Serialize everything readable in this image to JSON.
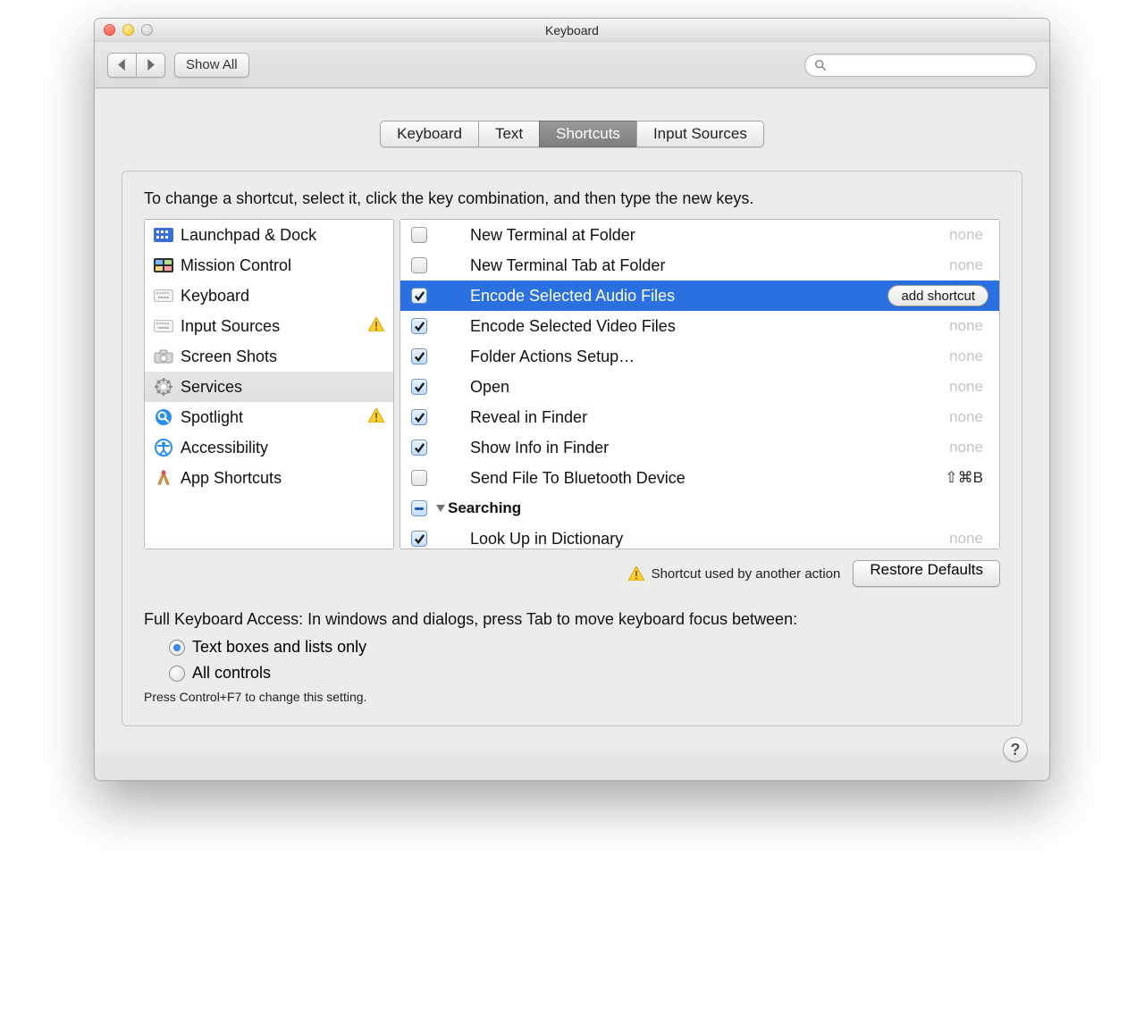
{
  "window": {
    "title": "Keyboard"
  },
  "toolbar": {
    "show_all": "Show All",
    "search_placeholder": ""
  },
  "tabs": [
    "Keyboard",
    "Text",
    "Shortcuts",
    "Input Sources"
  ],
  "tabs_selected_index": 2,
  "instruction": "To change a shortcut, select it, click the key combination, and then type the new keys.",
  "categories": [
    {
      "label": "Launchpad & Dock",
      "icon": "launchpad",
      "warn": false
    },
    {
      "label": "Mission Control",
      "icon": "mission",
      "warn": false
    },
    {
      "label": "Keyboard",
      "icon": "keyboard",
      "warn": false
    },
    {
      "label": "Input Sources",
      "icon": "keyboard",
      "warn": true
    },
    {
      "label": "Screen Shots",
      "icon": "camera",
      "warn": false
    },
    {
      "label": "Services",
      "icon": "gear",
      "warn": false,
      "selected": true
    },
    {
      "label": "Spotlight",
      "icon": "spotlight",
      "warn": true
    },
    {
      "label": "Accessibility",
      "icon": "accessibility",
      "warn": false
    },
    {
      "label": "App Shortcuts",
      "icon": "app",
      "warn": false
    }
  ],
  "shortcuts": [
    {
      "label": "New Terminal at Folder",
      "checked": false,
      "shortcut": "none",
      "selected": false
    },
    {
      "label": "New Terminal Tab at Folder",
      "checked": false,
      "shortcut": "none",
      "selected": false
    },
    {
      "label": "Encode Selected Audio Files",
      "checked": true,
      "shortcut": "add shortcut",
      "selected": true,
      "shortcut_pill": true
    },
    {
      "label": "Encode Selected Video Files",
      "checked": true,
      "shortcut": "none",
      "selected": false
    },
    {
      "label": "Folder Actions Setup…",
      "checked": true,
      "shortcut": "none",
      "selected": false
    },
    {
      "label": "Open",
      "checked": true,
      "shortcut": "none",
      "selected": false
    },
    {
      "label": "Reveal in Finder",
      "checked": true,
      "shortcut": "none",
      "selected": false
    },
    {
      "label": "Show Info in Finder",
      "checked": true,
      "shortcut": "none",
      "selected": false
    },
    {
      "label": "Send File To Bluetooth Device",
      "checked": false,
      "shortcut": "⇧⌘B",
      "shortcut_strong": true,
      "selected": false
    },
    {
      "group": true,
      "label": "Searching",
      "checked": "mixed"
    },
    {
      "label": "Look Up in Dictionary",
      "checked": true,
      "shortcut": "none",
      "selected": false
    }
  ],
  "conflict_note": "Shortcut used by another action",
  "restore": "Restore Defaults",
  "fka": {
    "label": "Full Keyboard Access: In windows and dialogs, press Tab to move keyboard focus between:",
    "options": [
      "Text boxes and lists only",
      "All controls"
    ],
    "selected_index": 0,
    "hint": "Press Control+F7 to change this setting."
  },
  "help_glyph": "?"
}
